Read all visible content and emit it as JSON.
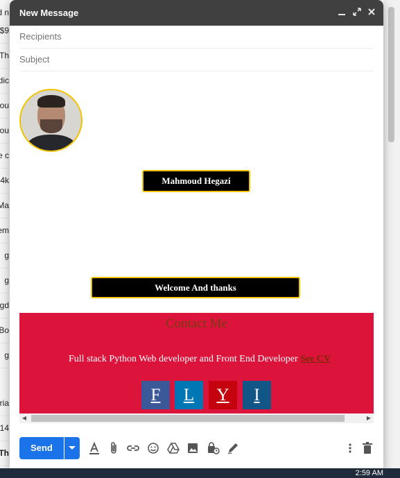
{
  "background_list": {
    "rows": [
      "d n",
      "$9",
      "Th",
      "dic",
      "ou",
      "ou",
      "e c",
      "4k",
      "Ma",
      "em",
      "g",
      "g",
      "gd",
      "Bo",
      "g",
      "tria",
      "14",
      "Th"
    ]
  },
  "compose": {
    "title": "New Message",
    "recipients_placeholder": "Recipients",
    "subject_placeholder": "Subject",
    "send_label": "Send"
  },
  "signature": {
    "name": "Mahmoud Hegazi",
    "welcome": "Welcome And thanks",
    "contact_title": "Contact Me",
    "description": "Full stack Python Web developer and Front End Developer",
    "cv_link": "See CV",
    "social": [
      {
        "letter": "F",
        "color": "#3b5998"
      },
      {
        "letter": "L",
        "color": "#0077b5"
      },
      {
        "letter": "Y",
        "color": "#c4030f"
      },
      {
        "letter": "I",
        "color": "#125688"
      }
    ]
  },
  "taskbar": {
    "time": "2:59 AM"
  },
  "colors": {
    "titlebar": "#404040",
    "accent": "#1a73e8",
    "contact_bg": "#dc143c",
    "badge_border": "#f2c300"
  }
}
